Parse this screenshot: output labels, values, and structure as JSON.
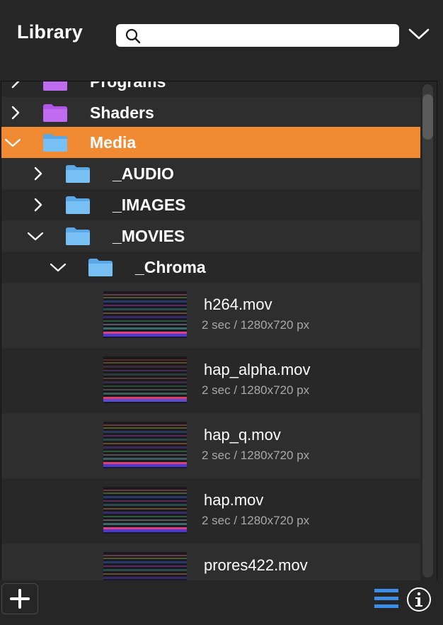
{
  "header": {
    "title": "Library",
    "search_placeholder": "",
    "search_value": ""
  },
  "tree": {
    "rows": [
      {
        "label": "Programs",
        "folder_color": "#b055e8",
        "expanded": false
      },
      {
        "label": "Shaders",
        "folder_color": "#b055e8",
        "expanded": false
      },
      {
        "label": "Media",
        "folder_color": "#6ab8f0",
        "expanded": true,
        "selected": true
      },
      {
        "label": "_AUDIO",
        "folder_color": "#6ab8f0",
        "expanded": false
      },
      {
        "label": "_IMAGES",
        "folder_color": "#6ab8f0",
        "expanded": false
      },
      {
        "label": "_MOVIES",
        "folder_color": "#6ab8f0",
        "expanded": true
      },
      {
        "label": "_Chroma",
        "folder_color": "#6ab8f0",
        "expanded": true
      }
    ],
    "files": [
      {
        "name": "h264.mov",
        "meta": "2 sec / 1280x720 px"
      },
      {
        "name": "hap_alpha.mov",
        "meta": "2 sec / 1280x720 px"
      },
      {
        "name": "hap_q.mov",
        "meta": "2 sec / 1280x720 px"
      },
      {
        "name": "hap.mov",
        "meta": "2 sec / 1280x720 px"
      },
      {
        "name": "prores422.mov",
        "meta": ""
      }
    ]
  },
  "colors": {
    "selection": "#f08a33",
    "accent_blue": "#3d8ee8"
  }
}
